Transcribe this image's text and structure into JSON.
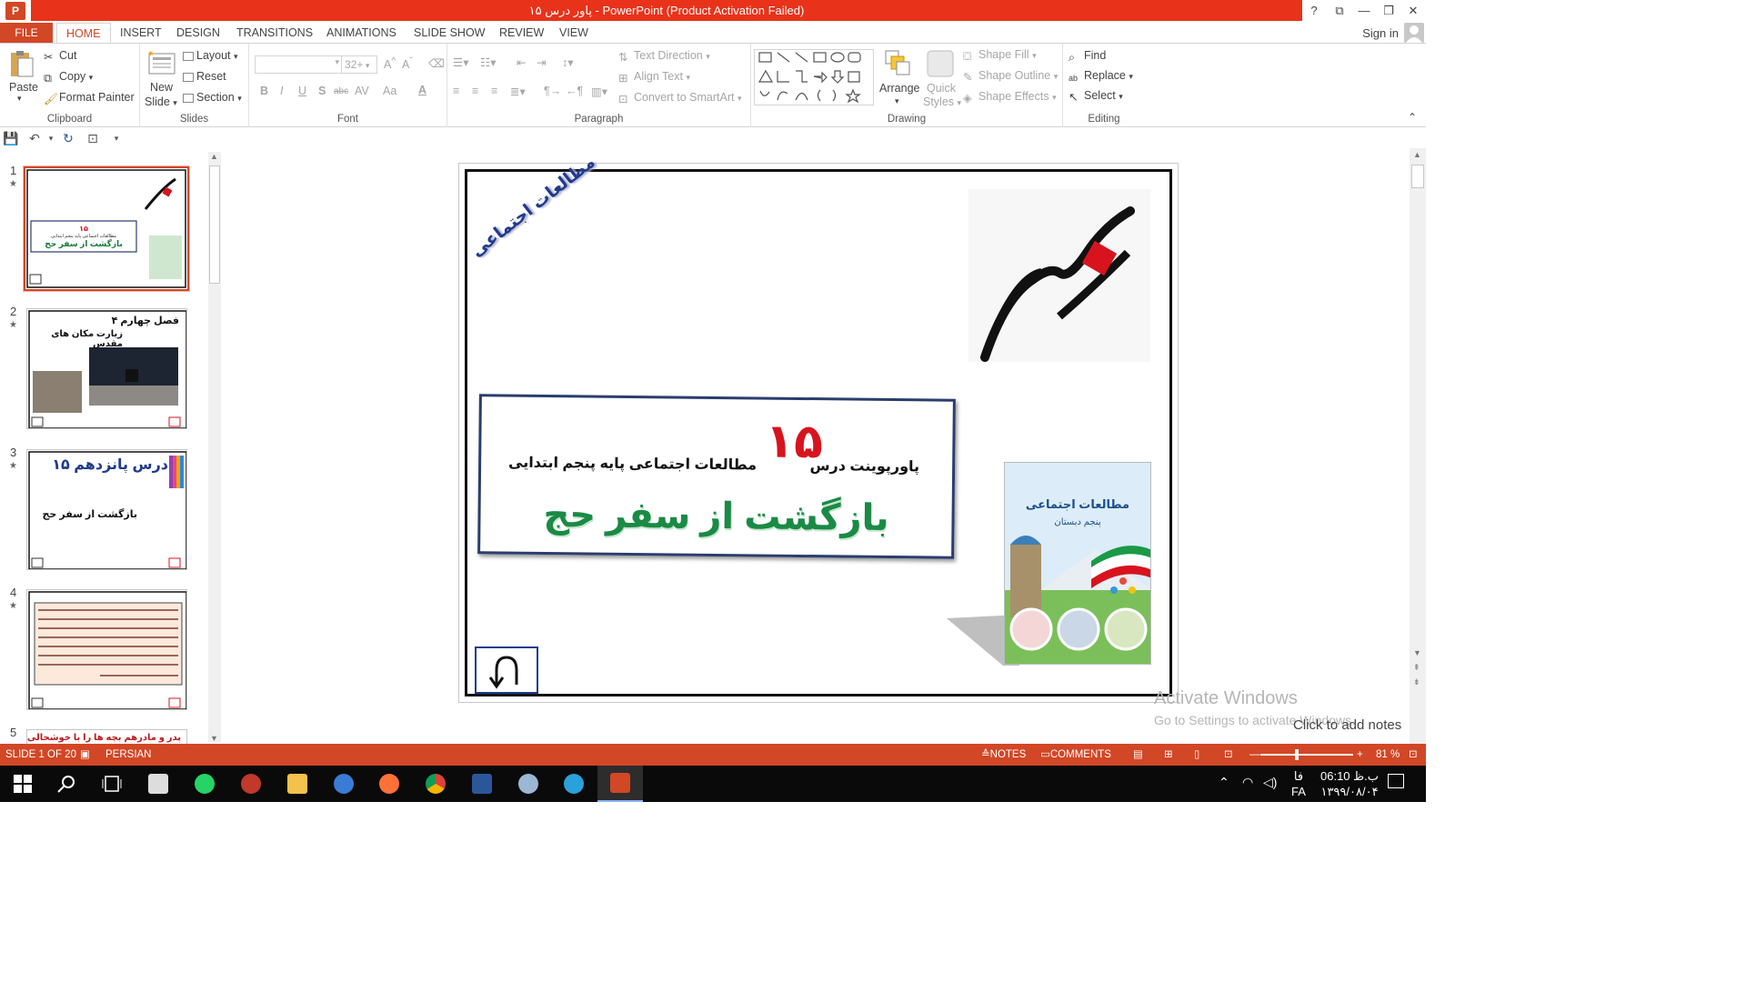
{
  "titlebar": {
    "app_logo": "P",
    "title": "پاور درس ۱۵  -  PowerPoint (Product Activation Failed)",
    "help": "?",
    "restore_ribbon": "⧉",
    "minimize": "—",
    "maximize": "❐",
    "close": "✕"
  },
  "tabs": {
    "file": "FILE",
    "items": [
      "HOME",
      "INSERT",
      "DESIGN",
      "TRANSITIONS",
      "ANIMATIONS",
      "SLIDE SHOW",
      "REVIEW",
      "VIEW"
    ],
    "sign_in": "Sign in"
  },
  "ribbon": {
    "clipboard": {
      "label": "Clipboard",
      "paste": "Paste",
      "cut": "Cut",
      "copy": "Copy",
      "format_painter": "Format Painter"
    },
    "slides": {
      "label": "Slides",
      "new_slide_1": "New",
      "new_slide_2": "Slide",
      "layout": "Layout",
      "reset": "Reset",
      "section": "Section"
    },
    "font": {
      "label": "Font",
      "font_size": "32+",
      "bold": "B",
      "italic": "I",
      "underline": "U",
      "shadow": "S",
      "strike": "abc",
      "spacing": "AV",
      "case": "Aa",
      "color": "A"
    },
    "paragraph": {
      "label": "Paragraph",
      "text_direction": "Text Direction",
      "align_text": "Align Text",
      "convert_smartart": "Convert to SmartArt"
    },
    "drawing": {
      "label": "Drawing",
      "arrange": "Arrange",
      "quick_styles_1": "Quick",
      "quick_styles_2": "Styles",
      "shape_fill": "Shape Fill",
      "shape_outline": "Shape Outline",
      "shape_effects": "Shape Effects"
    },
    "editing": {
      "label": "Editing",
      "find": "Find",
      "replace": "Replace",
      "select": "Select"
    }
  },
  "thumbnails": [
    {
      "num": "1",
      "title": "بازگشت از سفر حج",
      "sub": "مطالعات اجتماعی پایه پنجم ابتدایی",
      "big": "۱۵"
    },
    {
      "num": "2",
      "title": "فصل چهارم ۴",
      "sub": "زیارت مکان های مقدس"
    },
    {
      "num": "3",
      "title": "درس پانزدهم ۱۵",
      "sub": "بازگشت از سفر حج"
    },
    {
      "num": "4",
      "title": "",
      "sub": ""
    },
    {
      "num": "5",
      "title": "پدر و مادرهم بچه ها را با خوشحالی در"
    }
  ],
  "slide": {
    "corner_label": "مطالعات اجتماعی",
    "line1": "پاورپوینت درس",
    "number": "۱۵",
    "line2": "مطالعات اجتماعی پایه پنجم ابتدایی",
    "title": "بازگشت از سفر حج",
    "book_title": "مطالعات اجتماعی",
    "book_sub": "پنجم دبستان"
  },
  "watermark": {
    "line1": "Activate Windows",
    "line2": "Go to Settings to activate Windows."
  },
  "notes_hint": "Click to add notes",
  "status": {
    "slide_of": "SLIDE 1 OF 20",
    "language": "PERSIAN",
    "notes": "NOTES",
    "comments": "COMMENTS",
    "zoom": "81 %"
  },
  "taskbar": {
    "time": "06:10 ب.ظ",
    "date": "۱۳۹۹/۰۸/۰۴",
    "lang_top": "فا",
    "lang_bottom": "FA"
  },
  "colors": {
    "accent": "#d24726",
    "titlebar_red": "#e8321a",
    "slide_green": "#1f9d55",
    "slide_red": "#d7141e"
  }
}
